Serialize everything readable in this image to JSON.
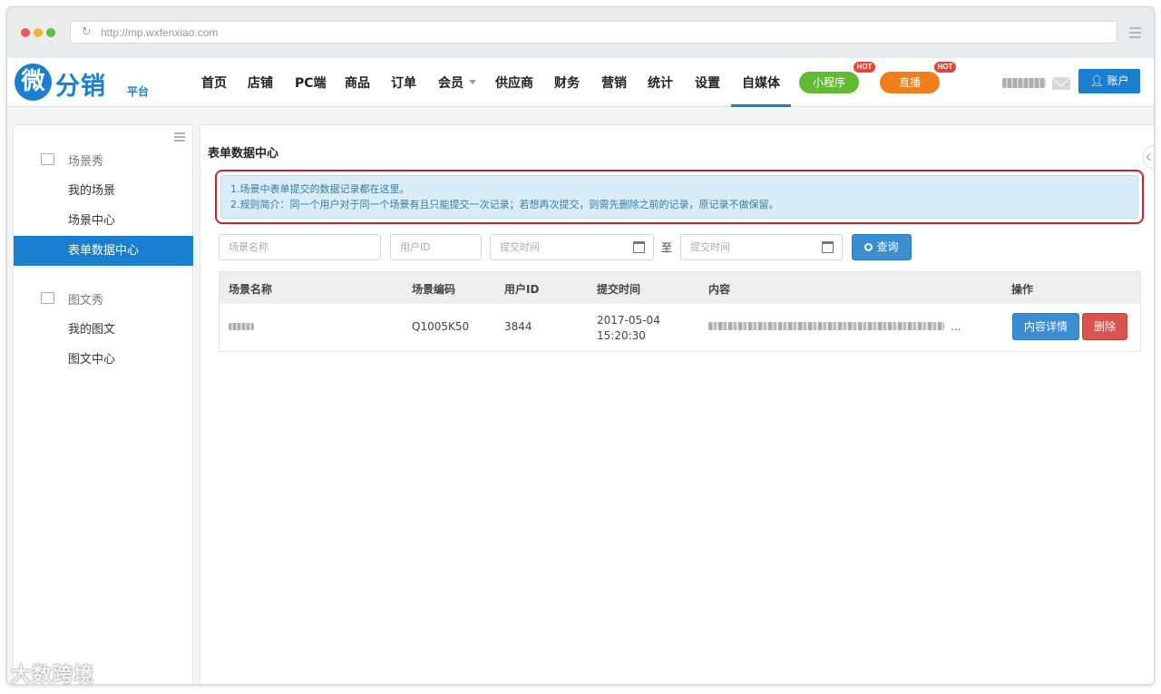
{
  "browser": {
    "url": "http://mp.wxfenxiao.com",
    "refresh_icon": "refresh-icon",
    "menu_icon": "hamburger-icon"
  },
  "brand": {
    "logo_char": "微",
    "logo_text": "分销",
    "logo_sub": "平台"
  },
  "nav": {
    "items": [
      "首页",
      "店铺",
      "PC端",
      "商品",
      "订单",
      "会员",
      "供应商",
      "财务",
      "营销",
      "统计",
      "设置",
      "自媒体"
    ],
    "active": "自媒体",
    "mini_program": "小程序",
    "live": "直播",
    "hot_badge": "HOT",
    "account_label": "账户",
    "accent_color": "#1a7fd0"
  },
  "sidebar": {
    "group1": "场景秀",
    "group1_items": [
      "我的场景",
      "场景中心",
      "表单数据中心"
    ],
    "group2": "图文秀",
    "group2_items": [
      "我的图文",
      "图文中心"
    ],
    "active": "表单数据中心"
  },
  "main": {
    "title": "表单数据中心",
    "notice_line1": "1.场景中表单提交的数据记录都在这里。",
    "notice_line2": "2.规则简介：同一个用户对于同一个场景有且只能提交一次记录；若想再次提交，则需先删除之前的记录，原记录不做保留。",
    "filter": {
      "scene_name_placeholder": "场景名称",
      "user_id_placeholder": "用户ID",
      "start_time_placeholder": "提交时间",
      "to_label": "至",
      "end_time_placeholder": "提交时间",
      "search_label": "查询"
    },
    "table": {
      "headers": [
        "场景名称",
        "场景编码",
        "用户ID",
        "提交时间",
        "内容",
        "操作"
      ],
      "rows": [
        {
          "scene_code": "Q1005K50",
          "user_id": "3844",
          "date": "2017-05-04",
          "time": "15:20:30",
          "content_ellipsis": "...",
          "detail_label": "内容详情",
          "delete_label": "删除"
        }
      ]
    }
  },
  "watermark": "大数跨境"
}
